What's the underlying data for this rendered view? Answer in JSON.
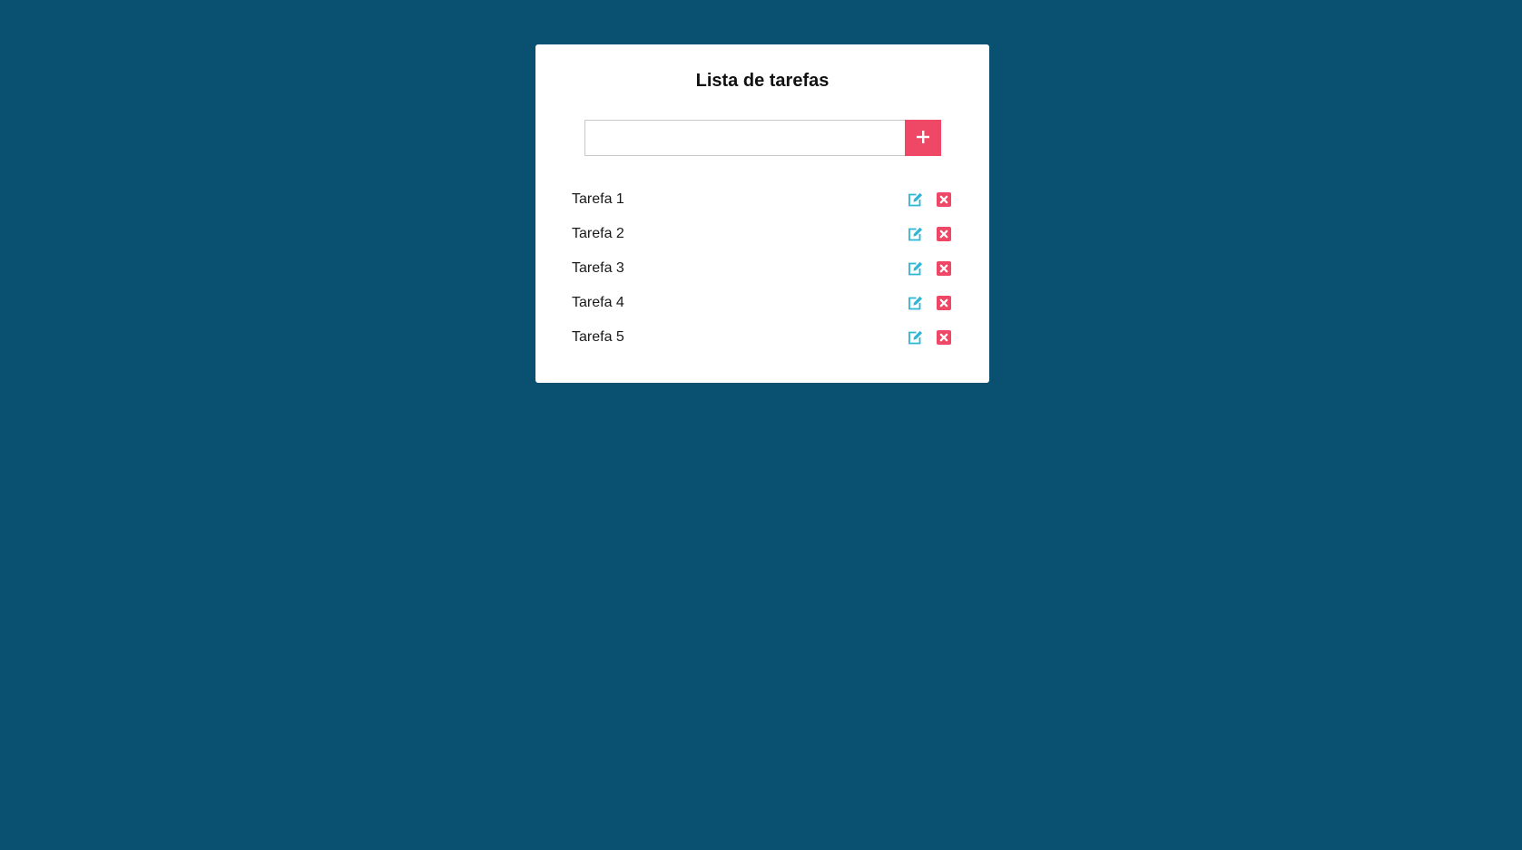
{
  "card": {
    "title": "Lista de tarefas"
  },
  "add_form": {
    "input_value": "",
    "input_placeholder": "",
    "add_button_icon": "plus-icon"
  },
  "tasks": [
    {
      "label": "Tarefa 1"
    },
    {
      "label": "Tarefa 2"
    },
    {
      "label": "Tarefa 3"
    },
    {
      "label": "Tarefa 4"
    },
    {
      "label": "Tarefa 5"
    }
  ],
  "icons": {
    "edit": "edit-icon",
    "delete": "close-square-icon"
  },
  "colors": {
    "background": "#0a5070",
    "accent": "#ef4766",
    "edit": "#2fb5d6"
  }
}
